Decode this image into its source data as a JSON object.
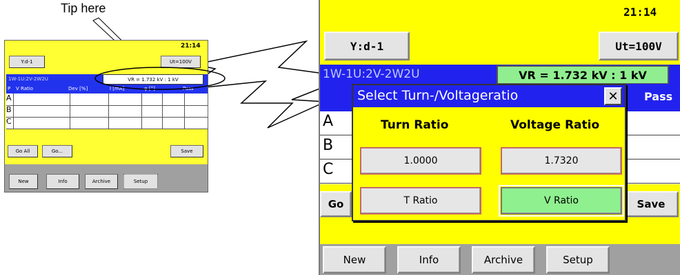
{
  "annotation": {
    "tip": "Tip here"
  },
  "screen": {
    "time": "21:14",
    "wiring_button": "Y:d-1",
    "voltage_button": "Ut=100V",
    "winding_label": "1W-1U:2V-2W2U",
    "ratio_display": "VR = 1.732 kV : 1 kV",
    "table_headers": {
      "p": "P",
      "ratio": "V Ratio",
      "dev": "Dev [%]",
      "current": "I [mA]",
      "phase": "φ [°]",
      "pass": "Pass"
    },
    "rows": [
      "A",
      "B",
      "C"
    ],
    "go_all_button": "Go All",
    "go_button": "Go...",
    "go_short": "Go",
    "save_button": "Save",
    "nav": {
      "new": "New",
      "info": "Info",
      "archive": "Archive",
      "setup": "Setup"
    }
  },
  "dialog": {
    "title": "Select Turn-/Voltageratio",
    "close": "✕",
    "col_turn": "Turn Ratio",
    "col_voltage": "Voltage Ratio",
    "turn_value": "1.0000",
    "voltage_value": "1.7320",
    "turn_button": "T Ratio",
    "voltage_button": "V Ratio",
    "selected": "V Ratio"
  },
  "colors": {
    "background": "#ffff00",
    "header_blue": "#2222ee",
    "selected_green": "#90ee90",
    "nav_gray": "#a0a0a0"
  }
}
